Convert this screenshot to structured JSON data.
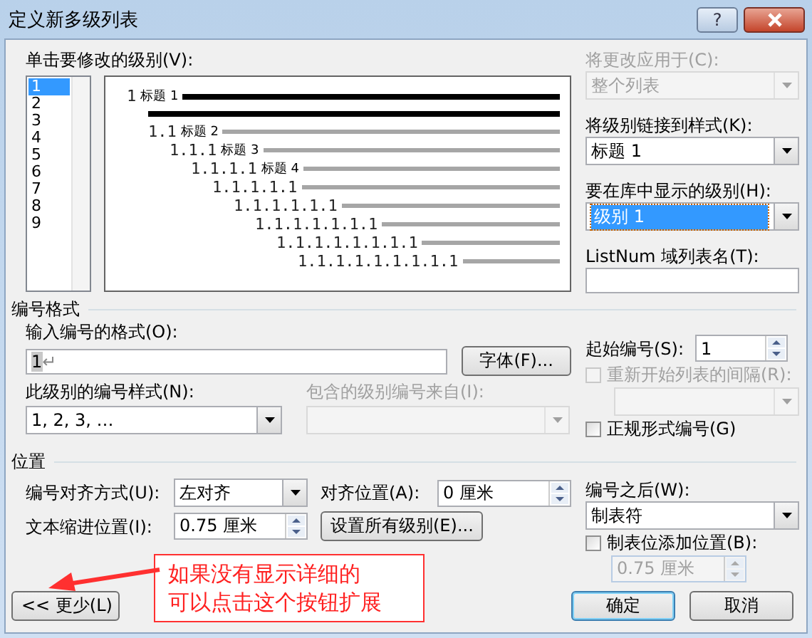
{
  "window": {
    "title": "定义新多级列表",
    "help_button": "?"
  },
  "level_list": {
    "label": "单击要修改的级别(V):",
    "items": [
      {
        "label": "1",
        "selected": true
      },
      {
        "label": "2",
        "selected": false
      },
      {
        "label": "3",
        "selected": false
      },
      {
        "label": "4",
        "selected": false
      },
      {
        "label": "5",
        "selected": false
      },
      {
        "label": "6",
        "selected": false
      },
      {
        "label": "7",
        "selected": false
      },
      {
        "label": "8",
        "selected": false
      },
      {
        "label": "9",
        "selected": false
      }
    ]
  },
  "preview": {
    "rows": [
      {
        "number": "1",
        "heading": "标题 1",
        "highlighted": true
      },
      {
        "number": "1.1",
        "heading": "标题 2",
        "highlighted": false
      },
      {
        "number": "1.1.1",
        "heading": "标题 3",
        "highlighted": false
      },
      {
        "number": "1.1.1.1",
        "heading": "标题 4",
        "highlighted": false
      },
      {
        "number": "1.1.1.1.1",
        "highlighted": false
      },
      {
        "number": "1.1.1.1.1.1",
        "highlighted": false
      },
      {
        "number": "1.1.1.1.1.1.1",
        "highlighted": false
      },
      {
        "number": "1.1.1.1.1.1.1.1",
        "highlighted": false
      },
      {
        "number": "1.1.1.1.1.1.1.1.1",
        "highlighted": false
      }
    ]
  },
  "apply_to": {
    "label": "将更改应用于(C):",
    "value": "整个列表",
    "disabled": true
  },
  "link_style": {
    "label": "将级别链接到样式(K):",
    "value": "标题 1",
    "disabled": false
  },
  "gallery_level": {
    "label": "要在库中显示的级别(H):",
    "value": "级别 1",
    "highlighted": true
  },
  "listnum": {
    "label": "ListNum 域列表名(T):"
  },
  "number_format": {
    "title": "编号格式",
    "format_label": "输入编号的格式(O):",
    "format_value": "1",
    "paragraph_mark": "↵",
    "font_button": "字体(F)...",
    "style_label": "此级别的编号样式(N):",
    "style_value": "1, 2, 3, …",
    "include_label": "包含的级别编号来自(I):",
    "include_disabled": true,
    "start_label": "起始编号(S):",
    "start_value": "1",
    "restart": {
      "label": "重新开始列表的间隔(R):",
      "checked": false,
      "disabled": true
    },
    "restart_dropdown_disabled": true,
    "legal": {
      "label": "正规形式编号(G)",
      "checked": false,
      "disabled": false
    }
  },
  "position": {
    "title": "位置",
    "align_label": "编号对齐方式(U):",
    "align_value": "左对齐",
    "align_at_label": "对齐位置(A):",
    "align_at_value": "0 厘米",
    "indent_label": "文本缩进位置(I):",
    "indent_value": "0.75 厘米",
    "set_all_button": "设置所有级别(E)...",
    "follow_label": "编号之后(W):",
    "follow_value": "制表符",
    "tab_stop": {
      "label": "制表位添加位置(B):",
      "checked": false,
      "disabled": false
    },
    "tab_stop_value": "0.75 厘米",
    "tab_stop_value_disabled": true
  },
  "annotation": {
    "lines": [
      "如果没有显示详细的",
      "可以点击这个按钮扩展"
    ]
  },
  "buttons": {
    "less": "<< 更少(L)",
    "ok": "确定",
    "cancel": "取消"
  }
}
